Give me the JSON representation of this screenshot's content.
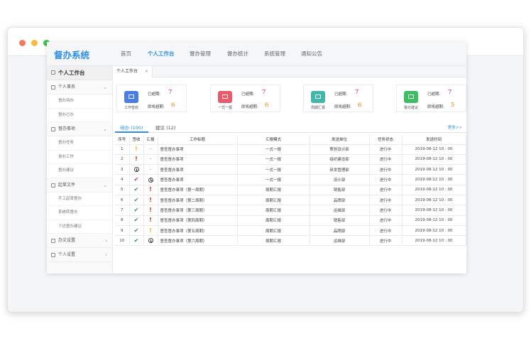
{
  "brand": "督办系统",
  "nav": [
    "首页",
    "个人工作台",
    "督办管理",
    "督办统计",
    "系统管理",
    "通知公告"
  ],
  "nav_active_index": 1,
  "sidebar": {
    "header": "个人工作台",
    "groups": [
      {
        "label": "个人事务",
        "items": [
          "督办待办",
          "督办已办"
        ]
      },
      {
        "label": "督办事项",
        "items": [
          "督办任务",
          "承办工作",
          "督办建议"
        ]
      },
      {
        "label": "起草文件",
        "items": [
          "手工起草督办",
          "系统转督办",
          "下达督办建议"
        ]
      },
      {
        "label": "办文设置",
        "items": []
      },
      {
        "label": "个人设置",
        "items": []
      }
    ]
  },
  "open_tab": {
    "label": "个人工作台",
    "close": "×"
  },
  "cards": [
    {
      "name": "工作签收",
      "overdue_label": "已超期:",
      "overdue": "7",
      "soon_label": "即将超期:",
      "soon": "6",
      "color": "#4a7de8"
    },
    {
      "name": "一式一报",
      "overdue_label": "已超期:",
      "overdue": "7",
      "soon_label": "即将超期:",
      "soon": "6",
      "color": "#ea5a6a"
    },
    {
      "name": "周期汇报",
      "overdue_label": "已超期:",
      "overdue": "7",
      "soon_label": "即将超期:",
      "soon": "6",
      "color": "#42b7a8"
    },
    {
      "name": "督办建议",
      "overdue_label": "已超期:",
      "overdue": "7",
      "soon_label": "即将超期:",
      "soon": "5",
      "color": "#3bbf60"
    }
  ],
  "subtabs": [
    {
      "label": "待办 (100)"
    },
    {
      "label": "建议 (12)"
    }
  ],
  "more": "更多>>",
  "table": {
    "columns": [
      "序号",
      "签收",
      "汇报",
      "工作标题",
      "汇报模式",
      "发送单位",
      "任务状态",
      "发送时间"
    ],
    "rows": [
      {
        "no": "1",
        "sign": "excl-y",
        "report": "-",
        "title": "督查督办事项",
        "mode": "一式一报",
        "unit": "策划设计部",
        "status": "进行中",
        "time": "2019-08-12 10 : 00"
      },
      {
        "no": "2",
        "sign": "excl-r",
        "report": "-",
        "title": "督查督办事项",
        "mode": "一式一报",
        "unit": "组织建设部",
        "status": "进行中",
        "time": "2019-08-12 10 : 00"
      },
      {
        "no": "3",
        "sign": "clock",
        "report": "-",
        "title": "督查督办事项",
        "mode": "一式一报",
        "unit": "研发管理部",
        "status": "进行中",
        "time": "2019-08-12 10 : 00"
      },
      {
        "no": "4",
        "sign": "check-r",
        "report": "clock",
        "title": "督查督办事项",
        "mode": "一式一报",
        "unit": "设计部",
        "status": "进行中",
        "time": "2019-08-12 10 : 00"
      },
      {
        "no": "5",
        "sign": "check-g",
        "report": "excl-r",
        "title": "督查督办事项（第一周期）",
        "mode": "周期汇报",
        "unit": "销售部",
        "status": "进行中",
        "time": "2019-08-12 10 : 00"
      },
      {
        "no": "6",
        "sign": "check-g",
        "report": "excl-r",
        "title": "督查督办事项（第二周期）",
        "mode": "周期汇报",
        "unit": "品牌部",
        "status": "进行中",
        "time": "2019-08-12 10 : 00"
      },
      {
        "no": "7",
        "sign": "check-g",
        "report": "excl-r",
        "title": "督查督办事项（第三周期）",
        "mode": "周期汇报",
        "unit": "运维部",
        "status": "进行中",
        "time": "2019-08-12 10 : 00"
      },
      {
        "no": "8",
        "sign": "check-g",
        "report": "excl-r",
        "title": "督查督办事项（第四周期）",
        "mode": "周期汇报",
        "unit": "销售部",
        "status": "进行中",
        "time": "2019-08-12 10 : 00"
      },
      {
        "no": "9",
        "sign": "check-g",
        "report": "excl-y",
        "title": "督查督办事项（第五周期）",
        "mode": "周期汇报",
        "unit": "品牌部",
        "status": "进行中",
        "time": "2019-08-12 10 : 00"
      },
      {
        "no": "10",
        "sign": "check-g",
        "report": "clock",
        "title": "督查督办事项（第六周期）",
        "mode": "周期汇报",
        "unit": "运维部",
        "status": "进行中",
        "time": "2019-08-12 10 : 00"
      }
    ]
  }
}
